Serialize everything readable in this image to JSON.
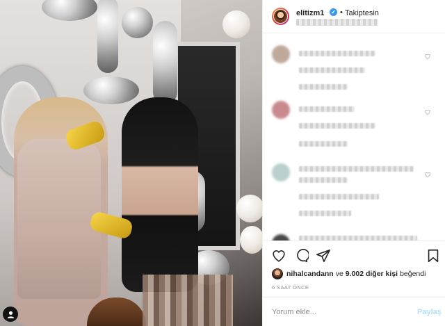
{
  "post": {
    "photo_alt": "",
    "corner_icon": "user-silhouette-icon"
  },
  "header": {
    "username": "elitizm1",
    "verified_glyph": "✔",
    "separator": "•",
    "follow_label": "Takiptesin",
    "avatar_icon": "profile-avatar"
  },
  "comments": [
    {
      "avatar_color": "#bfa99b"
    },
    {
      "avatar_color": "#c98a8e"
    },
    {
      "avatar_color": "#b9d0cf"
    },
    {
      "avatar_color": "#4a4a4a"
    }
  ],
  "actions": {
    "like_icon": "heart-icon",
    "comment_icon": "comment-bubble-icon",
    "share_icon": "paper-plane-icon",
    "save_icon": "bookmark-icon"
  },
  "likes": {
    "user": "nihalcandann",
    "connector": "ve",
    "others": "9.002 diğer kişi",
    "suffix": "beğendi"
  },
  "time": "6 SAAT ÖNCE",
  "add_comment": {
    "placeholder": "Yorum ekle...",
    "share_label": "Paylaş"
  },
  "colors": {
    "verified": "#3897f0",
    "share_disabled": "#b2dffc",
    "muted_text": "#8e8e8e"
  }
}
